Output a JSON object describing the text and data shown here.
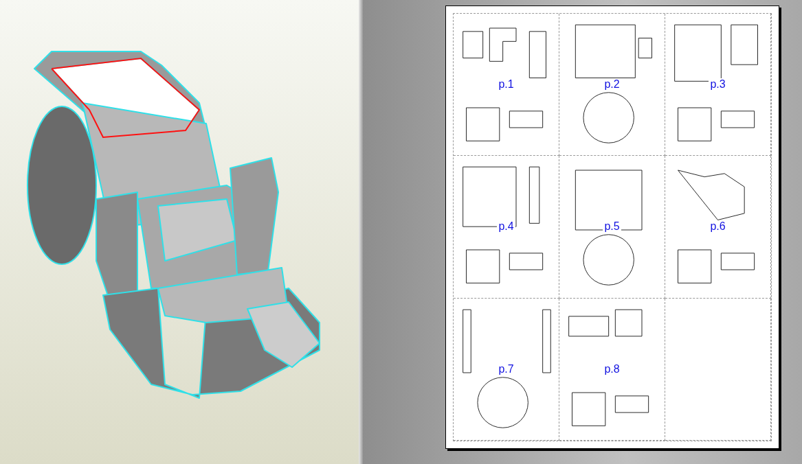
{
  "pages": [
    {
      "label": "p.1"
    },
    {
      "label": "p.2"
    },
    {
      "label": "p.3"
    },
    {
      "label": "p.4"
    },
    {
      "label": "p.5"
    },
    {
      "label": "p.6"
    },
    {
      "label": "p.7"
    },
    {
      "label": "p.8"
    }
  ]
}
